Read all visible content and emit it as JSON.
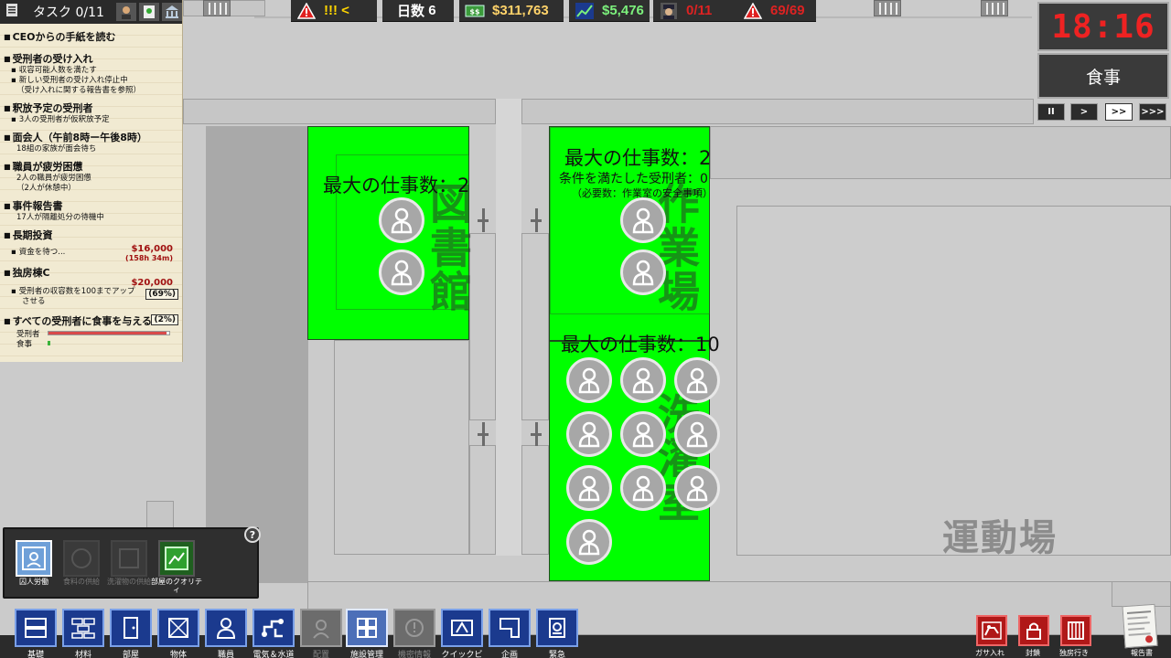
{
  "topbar": {
    "alerts": {
      "icon": "warning-triangle-icon",
      "value": "!!! <"
    },
    "days": {
      "label": "日数",
      "value": "6"
    },
    "cash": {
      "icon": "cash-icon",
      "value": "$311,763"
    },
    "income": {
      "icon": "trend-up-icon",
      "value": "$5,476"
    },
    "guards": {
      "icon": "guard-icon",
      "value": "0/11"
    },
    "danger": {
      "icon": "danger-triangle-icon",
      "value": "69/69"
    }
  },
  "tasks": {
    "header": "タスク 0/11",
    "items": [
      {
        "title": "CEOからの手紙を読む",
        "lines": []
      },
      {
        "title": "受刑者の受け入れ",
        "lines": [
          "収容可能人数を満たす",
          "新しい受刑者の受け入れ停止中",
          "（受け入れに関する報告書を参照）"
        ]
      },
      {
        "title": "釈放予定の受刑者",
        "lines": [
          "3人の受刑者が仮釈放予定"
        ]
      },
      {
        "title": "面会人（午前8時ー午後8時）",
        "lines": [
          "18組の家族が面会待ち"
        ]
      },
      {
        "title": "職員が疲労困憊",
        "lines": [
          "2人の職員が疲労困憊",
          "（2人が休憩中）"
        ]
      },
      {
        "title": "事件報告書",
        "lines": [
          "17人が隔離処分の待機中"
        ]
      },
      {
        "title": "長期投資",
        "lines": [
          "資金を待つ..."
        ],
        "money": "$16,000",
        "time": "(158h 34m)"
      },
      {
        "title": "独房棟C",
        "lines": [
          "受刑者の収容数を100までアップ",
          "させる"
        ],
        "money": "$20,000",
        "pct": "(69%)"
      },
      {
        "title": "すべての受刑者に食事を与える",
        "pct": "(2%)",
        "bars": [
          "受刑者",
          "食事"
        ],
        "bar_fill": [
          0.98,
          0.02
        ]
      }
    ]
  },
  "clock": {
    "time": "18:16",
    "phase": "食事"
  },
  "speed": [
    {
      "label": "II"
    },
    {
      "label": ">"
    },
    {
      "label": ">>"
    },
    {
      "label": ">>>"
    }
  ],
  "rooms": {
    "library": {
      "name": "図書館",
      "job_text": "最大の仕事数：2"
    },
    "workshop": {
      "name": "作業場",
      "job_text": "最大の仕事数：2",
      "qualified": "条件を満たした受刑者：0",
      "requirement": "（必要数：作業室の安全事項）"
    },
    "laundry": {
      "name": "洗濯室",
      "job_text": "最大の仕事数：10"
    },
    "yard": {
      "name": "運動場"
    }
  },
  "subpanel": {
    "items": [
      {
        "label": "囚人労働",
        "state": "active"
      },
      {
        "label": "食料の供給",
        "state": "disabled"
      },
      {
        "label": "洗濯物の供給",
        "state": "disabled"
      },
      {
        "label": "部屋のクオリティ",
        "state": "normal"
      }
    ],
    "help": "?"
  },
  "toolbar": {
    "tools": [
      {
        "label": "基礎",
        "icon": "foundation-icon",
        "state": "normal"
      },
      {
        "label": "材料",
        "icon": "bricks-icon",
        "state": "normal"
      },
      {
        "label": "部屋",
        "icon": "door-icon",
        "state": "normal"
      },
      {
        "label": "物体",
        "icon": "crate-icon",
        "state": "normal"
      },
      {
        "label": "職員",
        "icon": "staff-icon",
        "state": "normal"
      },
      {
        "label": "電気＆水道",
        "icon": "utilities-icon",
        "state": "normal"
      },
      {
        "label": "配置",
        "icon": "deploy-icon",
        "state": "disabled"
      },
      {
        "label": "施設管理",
        "icon": "grid-icon",
        "state": "selected"
      },
      {
        "label": "機密情報",
        "icon": "intel-icon",
        "state": "disabled"
      },
      {
        "label": "クイックビ",
        "icon": "quickbuild-icon",
        "state": "normal"
      },
      {
        "label": "企画",
        "icon": "planning-icon",
        "state": "normal"
      },
      {
        "label": "緊急",
        "icon": "emergency-icon",
        "state": "normal"
      }
    ],
    "right": [
      {
        "label": "ガサ入れ",
        "icon": "search-dog-icon"
      },
      {
        "label": "封鎖",
        "icon": "lock-icon"
      },
      {
        "label": "独房行き",
        "icon": "cell-icon"
      }
    ],
    "reports": {
      "label": "報告書",
      "icon": "report-icon"
    }
  }
}
